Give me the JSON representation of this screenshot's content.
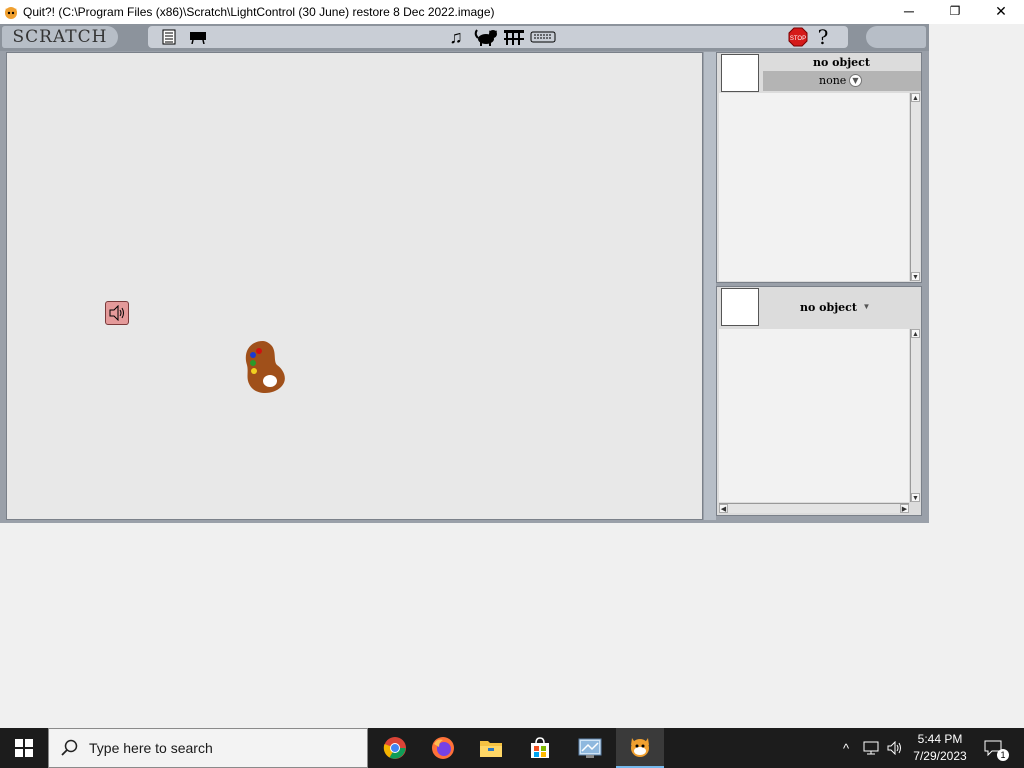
{
  "window": {
    "title": "Quit?! (C:\\Program Files (x86)\\Scratch\\LightControl (30 June) restore 8 Dec 2022.image)",
    "minimize": "─",
    "restore": "❐",
    "close": "✕"
  },
  "scratch": {
    "logo": "SCRATCH",
    "toolbar_icons": [
      "document-icon",
      "presentation-icon",
      "music-note-icon",
      "cat-icon",
      "bridge-icon",
      "keyboard-icon"
    ],
    "stop_label": "STOP",
    "help_label": "?",
    "top_panel": {
      "object_label": "no object",
      "dropdown_value": "none"
    },
    "bottom_panel": {
      "object_label": "no object"
    }
  },
  "taskbar": {
    "search_placeholder": "Type here to search",
    "apps": [
      "chrome-icon",
      "firefox-icon",
      "file-explorer-icon",
      "store-icon",
      "control-panel-icon",
      "scratch-icon"
    ],
    "time": "5:44 PM",
    "date": "7/29/2023",
    "notification_count": "1"
  }
}
